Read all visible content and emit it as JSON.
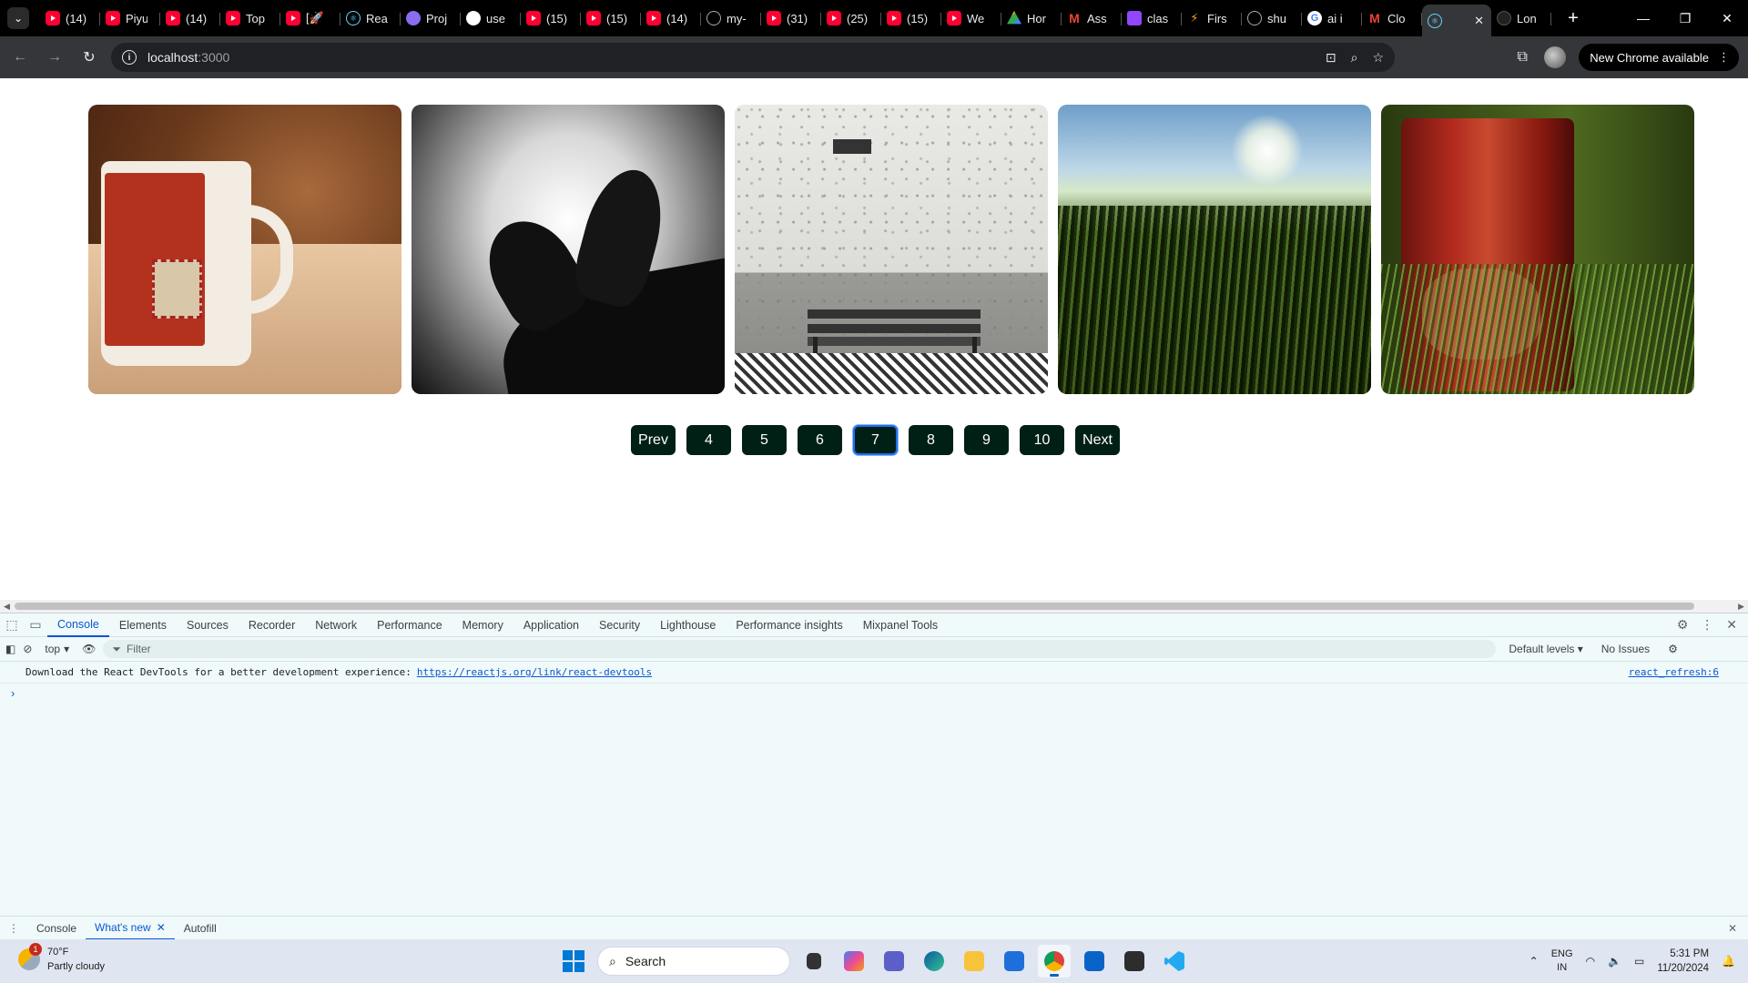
{
  "browser": {
    "tabs": [
      {
        "icon": "youtube-icon",
        "title": "(14)"
      },
      {
        "icon": "youtube-icon",
        "title": "Piyu"
      },
      {
        "icon": "youtube-icon",
        "title": "(14)"
      },
      {
        "icon": "youtube-icon",
        "title": "Top"
      },
      {
        "icon": "youtube-icon",
        "title": "[🚀"
      },
      {
        "icon": "react-icon",
        "title": "Rea"
      },
      {
        "icon": "violet-site-icon",
        "title": "Proj"
      },
      {
        "icon": "openai-icon",
        "title": "use"
      },
      {
        "icon": "youtube-icon",
        "title": "(15)"
      },
      {
        "icon": "youtube-icon",
        "title": "(15)"
      },
      {
        "icon": "youtube-icon",
        "title": "(14)"
      },
      {
        "icon": "github-icon",
        "title": "my-"
      },
      {
        "icon": "youtube-icon",
        "title": "(31)"
      },
      {
        "icon": "youtube-icon",
        "title": "(25)"
      },
      {
        "icon": "youtube-icon",
        "title": "(15)"
      },
      {
        "icon": "youtube-icon",
        "title": "We"
      },
      {
        "icon": "drive-icon",
        "title": "Hor"
      },
      {
        "icon": "gmail-icon",
        "title": "Ass"
      },
      {
        "icon": "twitch-icon",
        "title": "clas"
      },
      {
        "icon": "fire-icon",
        "title": "Firs"
      },
      {
        "icon": "github-icon",
        "title": "shu"
      },
      {
        "icon": "google-icon",
        "title": "ai i"
      },
      {
        "icon": "gmail-icon",
        "title": "Clo"
      }
    ],
    "active_tab": {
      "icon": "react-icon",
      "title": ""
    },
    "after_tab": {
      "icon": "dark-site-icon",
      "title": "Lon"
    },
    "url_host": "localhost",
    "url_port": ":3000",
    "update_label": "New Chrome available"
  },
  "page": {
    "photos": [
      {
        "alt": "red coffee mug"
      },
      {
        "alt": "black and white feet"
      },
      {
        "alt": "bench against white wall"
      },
      {
        "alt": "grass field in sunlight"
      },
      {
        "alt": "rusty red barrel in grass"
      }
    ],
    "pagination": {
      "prev": "Prev",
      "pages": [
        "4",
        "5",
        "6",
        "7",
        "8",
        "9",
        "10"
      ],
      "current": "7",
      "next": "Next"
    }
  },
  "devtools": {
    "tabs": [
      "Console",
      "Elements",
      "Sources",
      "Recorder",
      "Network",
      "Performance",
      "Memory",
      "Application",
      "Security",
      "Lighthouse",
      "Performance insights",
      "Mixpanel Tools"
    ],
    "active_tab": "Console",
    "context": "top",
    "filter_placeholder": "Filter",
    "levels": "Default levels",
    "issues": "No Issues",
    "message": "Download the React DevTools for a better development experience:",
    "message_link": "https://reactjs.org/link/react-devtools",
    "message_source": "react_refresh:6",
    "drawer_tabs": [
      "Console",
      "What's new",
      "Autofill"
    ],
    "drawer_active": "What's new"
  },
  "taskbar": {
    "weather_temp": "70°F",
    "weather_desc": "Partly cloudy",
    "weather_badge": "1",
    "search_placeholder": "Search",
    "lang_1": "ENG",
    "lang_2": "IN",
    "time": "5:31 PM",
    "date": "11/20/2024"
  }
}
